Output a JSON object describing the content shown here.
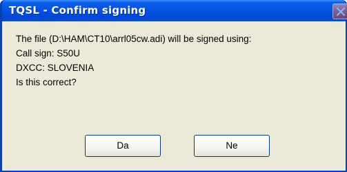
{
  "window": {
    "title": "TQSL - Confirm signing",
    "close_icon": "close-icon"
  },
  "message": {
    "line1": "The file (D:\\HAM\\CT10\\arrl05cw.adi) will be signed using:",
    "line2": "Call sign: S50U",
    "line3": "DXCC: SLOVENIA",
    "line4": "Is this correct?"
  },
  "buttons": {
    "yes_label": "Da",
    "no_label": "Ne"
  },
  "colors": {
    "titlebar": "#0553e2",
    "dialog_background": "#ece9d8",
    "button_border": "#003c74"
  }
}
